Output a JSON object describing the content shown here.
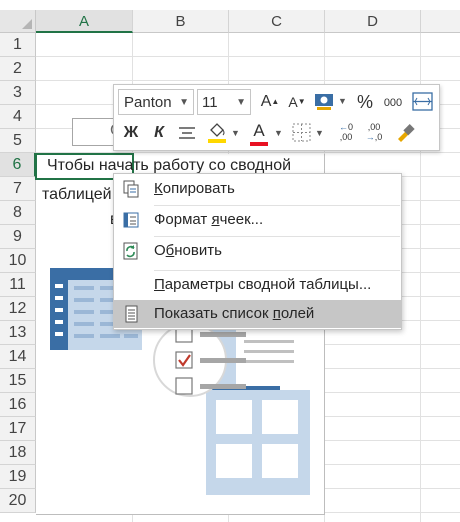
{
  "columns": [
    "A",
    "B",
    "C",
    "D"
  ],
  "rows": [
    "1",
    "2",
    "3",
    "4",
    "5",
    "6",
    "7",
    "8",
    "9",
    "10",
    "11",
    "12",
    "13",
    "14",
    "15",
    "16",
    "17",
    "18",
    "19",
    "20"
  ],
  "pivot": {
    "line1": "Чтобы начать работу со сводной",
    "line2": "таблицей",
    "line3": "в",
    "button_label": "С"
  },
  "toolbar": {
    "font_name": "Panton",
    "font_size": "11",
    "grow_font": "A",
    "shrink_font": "A",
    "percent": "%",
    "thousands": "000",
    "bold": "Ж",
    "italic": "К",
    "font_color_letter": "A",
    "dec_increase": "←0\n,00",
    "dec_decrease": ",00\n→,0",
    "accent_red": "#e81123",
    "fill_yellow": "#ffd800"
  },
  "menu": {
    "items": [
      {
        "label": "Копировать",
        "icon": "copy-icon",
        "accel": "К"
      },
      {
        "label": "Формат ячеек...",
        "icon": "format-cells-icon",
        "accel": "я"
      },
      {
        "label": "Обновить",
        "icon": "refresh-icon",
        "accel": "б"
      },
      {
        "label": "Параметры сводной таблицы...",
        "icon": "none",
        "accel": "П"
      },
      {
        "label": "Показать список полей",
        "icon": "field-list-icon",
        "accel": "п"
      }
    ]
  },
  "colors": {
    "excel_green": "#217346",
    "illustration_blue": "#3a6ea5",
    "illustration_light": "#c5d7ea"
  }
}
